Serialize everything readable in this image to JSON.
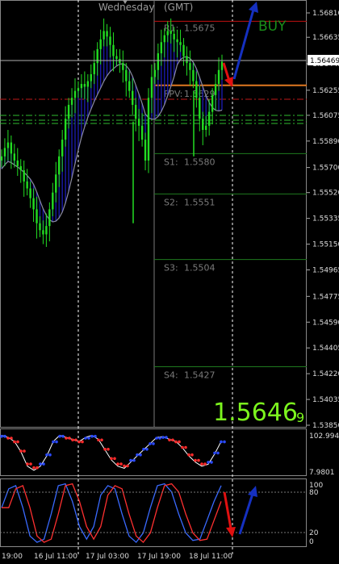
{
  "header": {
    "day_label": "Wednesday",
    "tz_label": "(GMT)"
  },
  "signal": {
    "label": "BUY",
    "color": "#1a8f1a"
  },
  "current_price": {
    "big": "1.5646",
    "small": "9",
    "axis": "1.56469"
  },
  "pivots": [
    {
      "label": "R1:",
      "value": "1.5675",
      "price": 1.5675,
      "color": "#c01010"
    },
    {
      "label": "FPV:",
      "value": "1.5629",
      "price": 1.5629,
      "color": "#e07820"
    },
    {
      "label": "S1:",
      "value": "1.5580",
      "price": 1.558,
      "color": "#1e7a1e"
    },
    {
      "label": "S2:",
      "value": "1.5551",
      "price": 1.5551,
      "color": "#1e7a1e"
    },
    {
      "label": "S3:",
      "value": "1.5504",
      "price": 1.5504,
      "color": "#1e7a1e"
    },
    {
      "label": "S4:",
      "value": "1.5427",
      "price": 1.5427,
      "color": "#1e7a1e"
    }
  ],
  "price_axis": [
    "1.56810",
    "1.56635",
    "1.56445",
    "1.56255",
    "1.56075",
    "1.55890",
    "1.55700",
    "1.55520",
    "1.55335",
    "1.55150",
    "1.54965",
    "1.54775",
    "1.54590",
    "1.54405",
    "1.54220",
    "1.54035",
    "1.53850"
  ],
  "osc1_axis": [
    "102.9948",
    "7.9801"
  ],
  "osc2_axis": [
    "100",
    "80",
    "20",
    "0"
  ],
  "time_axis": [
    "19:00",
    "16 Jul 11:00",
    "17 Jul 03:00",
    "17 Jul 19:00",
    "18 Jul 11:00"
  ],
  "colors": {
    "bull_candle": "#22dd22",
    "line_green": "#2fb82f",
    "ma_fill": "#1a1aa0",
    "stoch_red": "#ff3030",
    "stoch_blue": "#3a6aff",
    "arrow_red": "#e01010",
    "arrow_blue": "#1530c0"
  }
}
